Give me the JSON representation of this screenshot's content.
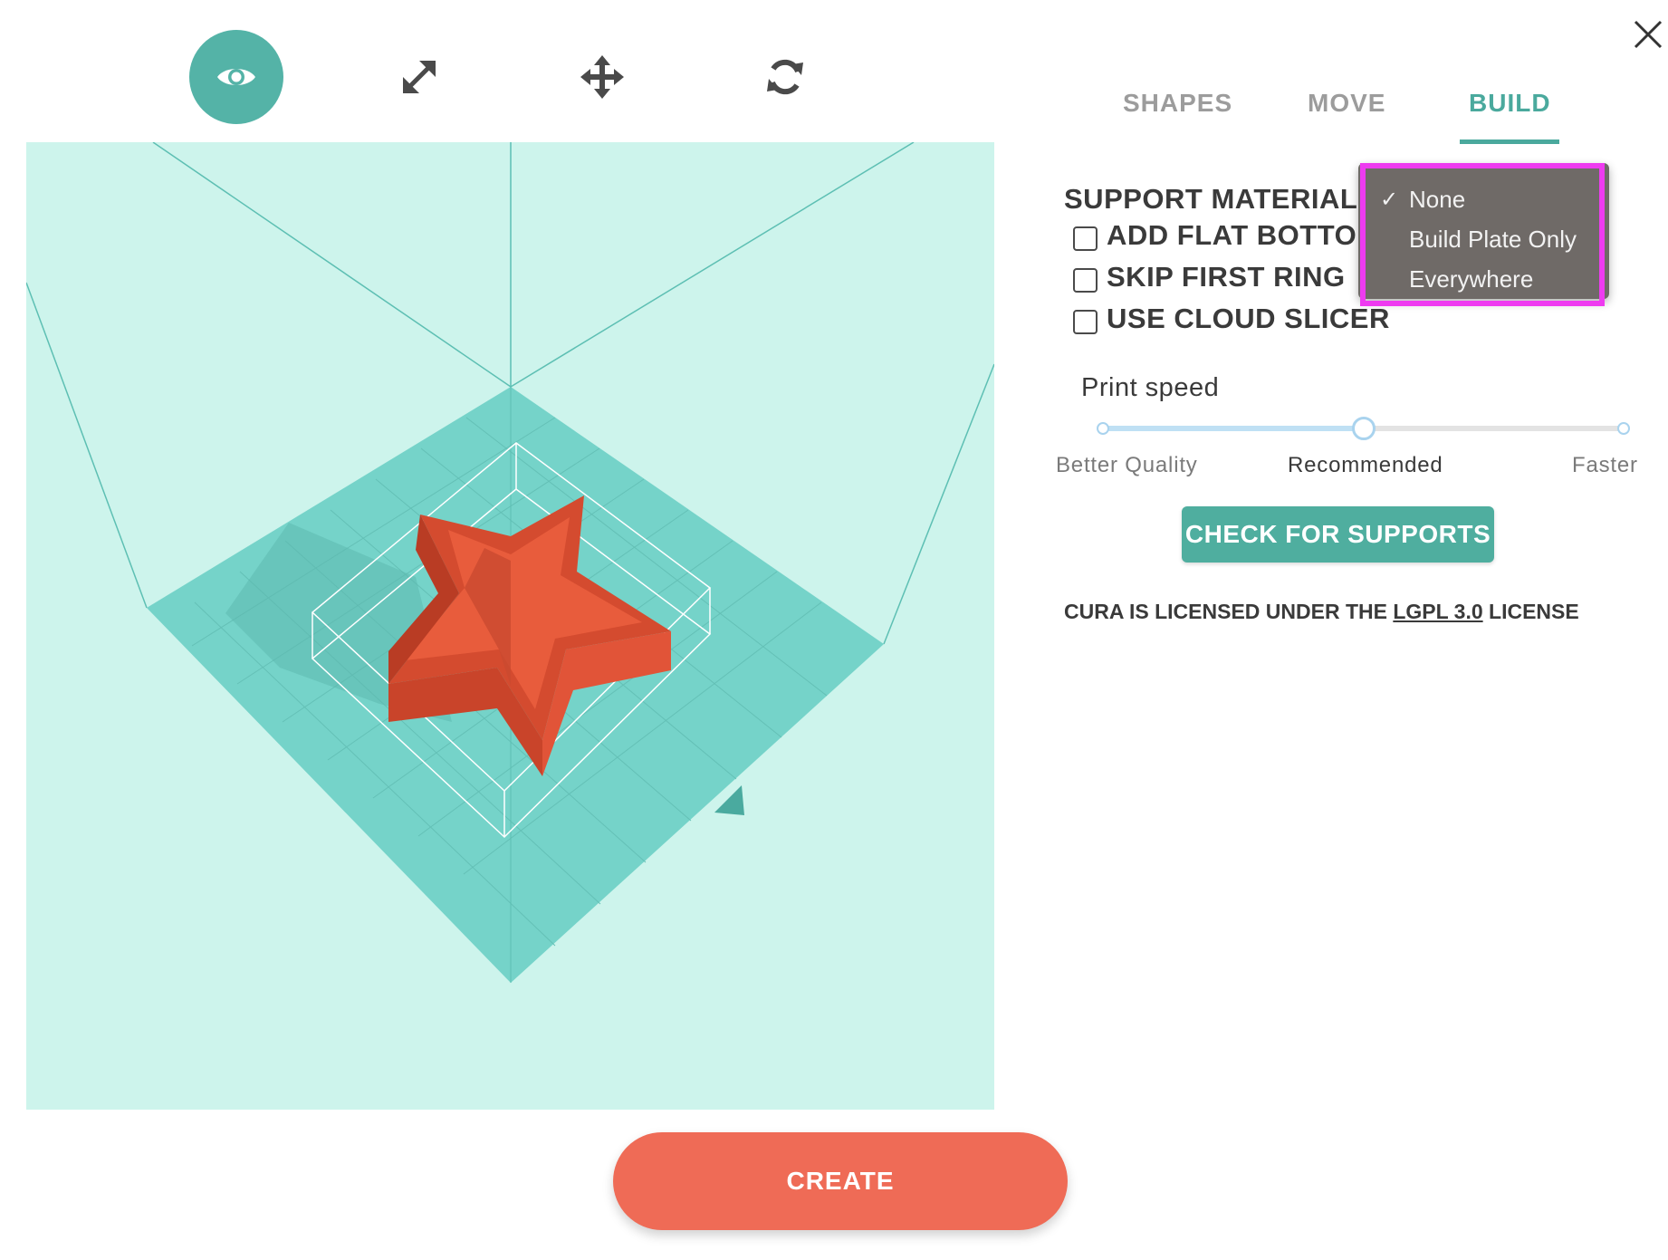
{
  "toolbar": {
    "tools": [
      {
        "name": "view",
        "icon": "eye-icon",
        "active": true
      },
      {
        "name": "scale",
        "icon": "resize-arrows-icon",
        "active": false
      },
      {
        "name": "move",
        "icon": "move-cross-icon",
        "active": false
      },
      {
        "name": "rotate",
        "icon": "rotate-arrows-icon",
        "active": false
      }
    ]
  },
  "close_icon": "close-icon",
  "tabs": [
    {
      "label": "SHAPES",
      "active": false
    },
    {
      "label": "MOVE",
      "active": false
    },
    {
      "label": "BUILD",
      "active": true
    }
  ],
  "build": {
    "support_material_label": "SUPPORT MATERIAL",
    "options": [
      {
        "label": "ADD FLAT BOTTOM",
        "checked": false
      },
      {
        "label": "SKIP FIRST RING",
        "checked": false
      },
      {
        "label": "USE CLOUD SLICER",
        "checked": false
      }
    ],
    "print_speed": {
      "label": "Print speed",
      "min_label": "Better Quality",
      "mid_label": "Recommended",
      "max_label": "Faster",
      "value": 0.5
    },
    "check_supports_label": "CHECK FOR SUPPORTS",
    "license": {
      "prefix": "CURA IS LICENSED UNDER THE",
      "link": "LGPL 3.0",
      "suffix": "LICENSE"
    }
  },
  "support_dropdown": {
    "options": [
      "None",
      "Build Plate Only",
      "Everywhere"
    ],
    "selected": "None",
    "check_glyph": "✓"
  },
  "create_label": "CREATE",
  "colors": {
    "accent": "#4aa99d",
    "viewport_bg": "#cdf4ec",
    "build_plate": "#75d3c9",
    "model": "#e85c3c",
    "create": "#ef6b56",
    "dropdown_bg": "#6f6a67",
    "highlight": "#ee3bf0"
  }
}
